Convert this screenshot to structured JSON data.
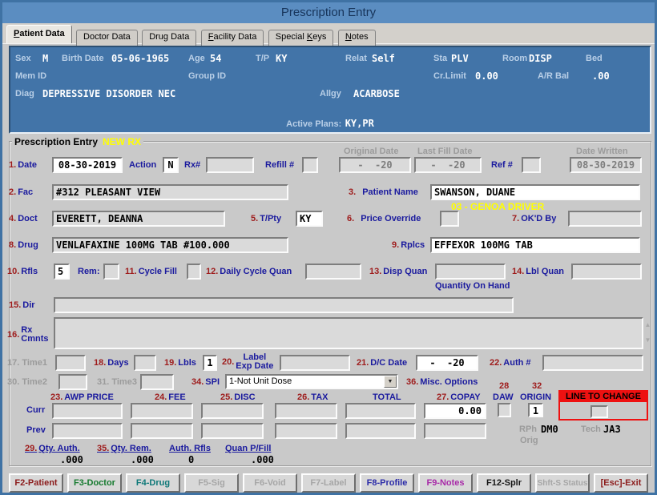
{
  "colors": {
    "titlebar": "#5b8dc1",
    "panel_blue": "#4274a8",
    "label_navy": "#1a1a9e",
    "label_red": "#9e1b1b",
    "disabled_gray": "#9b9b9b",
    "highlight_yellow": "#ffff00",
    "alert_red": "#ee1111"
  },
  "window": {
    "title": "Prescription Entry"
  },
  "tabs": {
    "patient": {
      "pre": "",
      "key": "P",
      "post": "atient Data"
    },
    "doctor": {
      "pre": "Doctor Data",
      "key": "",
      "post": ""
    },
    "drug": {
      "pre": "Drug Data",
      "key": "",
      "post": ""
    },
    "facility": {
      "pre": "",
      "key": "F",
      "post": "acility Data"
    },
    "special": {
      "pre": "Special ",
      "key": "K",
      "post": "eys"
    },
    "notes": {
      "pre": "",
      "key": "N",
      "post": "otes"
    }
  },
  "patient": {
    "sex_label": "Sex",
    "sex": "M",
    "birth_label": "Birth Date",
    "birth": "05-06-1965",
    "age_label": "Age",
    "age": "54",
    "tp_label": "T/P",
    "tp": "KY",
    "relat_label": "Relat",
    "relat": "Self",
    "sta_label": "Sta",
    "sta": "PLV",
    "room_label": "Room",
    "room": "DISP",
    "bed_label": "Bed",
    "bed": "",
    "memid_label": "Mem ID",
    "memid": "",
    "groupid_label": "Group ID",
    "groupid": "",
    "crlimit_label": "Cr.Limit",
    "crlimit": "0.00",
    "arbal_label": "A/R Bal",
    "arbal": ".00",
    "diag_label": "Diag",
    "diag": "DEPRESSIVE DISORDER NEC",
    "allgy_label": "Allgy",
    "allgy": "ACARBOSE",
    "plans_label": "Active Plans:",
    "plans": "KY,PR"
  },
  "form": {
    "group_title": "Prescription Entry",
    "new_rx": "NEW RX",
    "date": {
      "num": "1.",
      "label": "Date",
      "value": "08-30-2019"
    },
    "action": {
      "label": "Action",
      "value": "N"
    },
    "rx_number": {
      "label": "Rx#",
      "value": ""
    },
    "refill": {
      "label": "Refill #",
      "value": ""
    },
    "original_date": {
      "label": "Original Date",
      "value": "-  -20"
    },
    "last_fill_date": {
      "label": "Last Fill Date",
      "value": "-  -20"
    },
    "ref_number": {
      "label": "Ref #",
      "value": ""
    },
    "date_written": {
      "label": "Date Written",
      "value": "08-30-2019"
    },
    "fac": {
      "num": "2.",
      "label": "Fac",
      "value": "#312 PLEASANT VIEW"
    },
    "patient_name": {
      "num": "3.",
      "label": "Patient Name",
      "value": "SWANSON, DUANE"
    },
    "genoa_note": "03 - GENOA DRIVER",
    "doct": {
      "num": "4.",
      "label": "Doct",
      "value": "EVERETT, DEANNA"
    },
    "tpty": {
      "num": "5.",
      "label": "T/Pty",
      "value": "KY"
    },
    "price_override": {
      "num": "6.",
      "label": "Price Override",
      "value": ""
    },
    "okd_by": {
      "num": "7.",
      "label": "OK'D By",
      "value": ""
    },
    "drug": {
      "num": "8.",
      "label": "Drug",
      "value": "VENLAFAXINE 100MG TAB #100.000"
    },
    "rplcs": {
      "num": "9.",
      "label": "Rplcs",
      "value": "EFFEXOR 100MG TAB"
    },
    "rfls": {
      "num": "10.",
      "label": "Rfls",
      "value": "5"
    },
    "rem": {
      "label": "Rem:",
      "value": ""
    },
    "cycle_fill": {
      "num": "11.",
      "label": "Cycle Fill",
      "value": ""
    },
    "daily_cycle_quan": {
      "num": "12.",
      "label": "Daily Cycle Quan",
      "value": ""
    },
    "disp_quan": {
      "num": "13.",
      "label": "Disp Quan",
      "value": "",
      "note": "Quantity On Hand"
    },
    "lbl_quan": {
      "num": "14.",
      "label": "Lbl Quan",
      "value": ""
    },
    "dir": {
      "num": "15.",
      "label": "Dir",
      "value": ""
    },
    "rx_cmnts": {
      "num": "16.",
      "label1": "Rx",
      "label2": "Cmnts",
      "value": ""
    },
    "time1": {
      "num": "17.",
      "label": "Time1",
      "value": ""
    },
    "days": {
      "num": "18.",
      "label": "Days",
      "value": ""
    },
    "lbls": {
      "num": "19.",
      "label": "Lbls",
      "value": "1"
    },
    "label_exp_date": {
      "num": "20.",
      "label1": "Label",
      "label2": "Exp Date",
      "value": ""
    },
    "dc_date": {
      "num": "21.",
      "label": "D/C Date",
      "value": "-  -20"
    },
    "auth_number": {
      "num": "22.",
      "label": "Auth #",
      "value": ""
    },
    "time2": {
      "num": "30.",
      "label": "Time2",
      "value": ""
    },
    "time3": {
      "num": "31.",
      "label": "Time3",
      "value": ""
    },
    "spi": {
      "num": "34.",
      "label": "SPI",
      "value": "1-Not Unit Dose"
    },
    "misc_options": {
      "num": "36.",
      "label": "Misc. Options"
    },
    "daw": {
      "num": "28",
      "label": "DAW",
      "value": ""
    },
    "origin": {
      "num": "32",
      "label": "ORIGIN",
      "value": "1"
    },
    "line_to_change": {
      "label": "LINE TO CHANGE",
      "value": ""
    },
    "pricing": {
      "awp": {
        "num": "23.",
        "label": "AWP PRICE"
      },
      "fee": {
        "num": "24.",
        "label": "FEE"
      },
      "disc": {
        "num": "25.",
        "label": "DISC"
      },
      "tax": {
        "num": "26.",
        "label": "TAX"
      },
      "total_label": "TOTAL",
      "copay": {
        "num": "27.",
        "label": "COPAY"
      },
      "curr_label": "Curr",
      "prev_label": "Prev",
      "curr": {
        "awp": "",
        "fee": "",
        "disc": "",
        "tax": "",
        "total": "",
        "copay": "0.00"
      },
      "prev": {
        "awp": "",
        "fee": "",
        "disc": "",
        "tax": "",
        "total": "",
        "copay": ""
      }
    },
    "rph_label": "RPh",
    "rph": "DM0",
    "tech_label": "Tech",
    "tech": "JA3",
    "orig_label": "Orig",
    "qty_auth": {
      "num": "29.",
      "label": "Qty. Auth.",
      "value": ".000"
    },
    "qty_rem": {
      "num": "35.",
      "label": "Qty. Rem.",
      "value": ".000"
    },
    "auth_rfls": {
      "label": "Auth. Rfls",
      "value": "0"
    },
    "quan_pfill": {
      "label": "Quan P/Fill",
      "value": ".000"
    }
  },
  "buttons": {
    "f2": {
      "label": "F2-Patient",
      "color": "#8b1a1a",
      "enabled": true
    },
    "f3": {
      "label": "F3-Doctor",
      "color": "#157a2e",
      "enabled": true
    },
    "f4": {
      "label": "F4-Drug",
      "color": "#0d7878",
      "enabled": true
    },
    "f5": {
      "label": "F5-Sig",
      "color": "#a6a6a6",
      "enabled": false
    },
    "f6": {
      "label": "F6-Void",
      "color": "#a6a6a6",
      "enabled": false
    },
    "f7": {
      "label": "F7-Label",
      "color": "#a6a6a6",
      "enabled": false
    },
    "f8": {
      "label": "F8-Profile",
      "color": "#2a2aa8",
      "enabled": true
    },
    "f9": {
      "label": "F9-Notes",
      "color": "#a82aa8",
      "enabled": true
    },
    "f12": {
      "label": "F12-Splr",
      "color": "#141414",
      "enabled": true
    },
    "shft_s": {
      "label": "Shft-S Status",
      "color": "#a6a6a6",
      "enabled": false
    },
    "esc": {
      "label": "[Esc]-Exit",
      "color": "#8b1a1a",
      "enabled": true
    }
  }
}
